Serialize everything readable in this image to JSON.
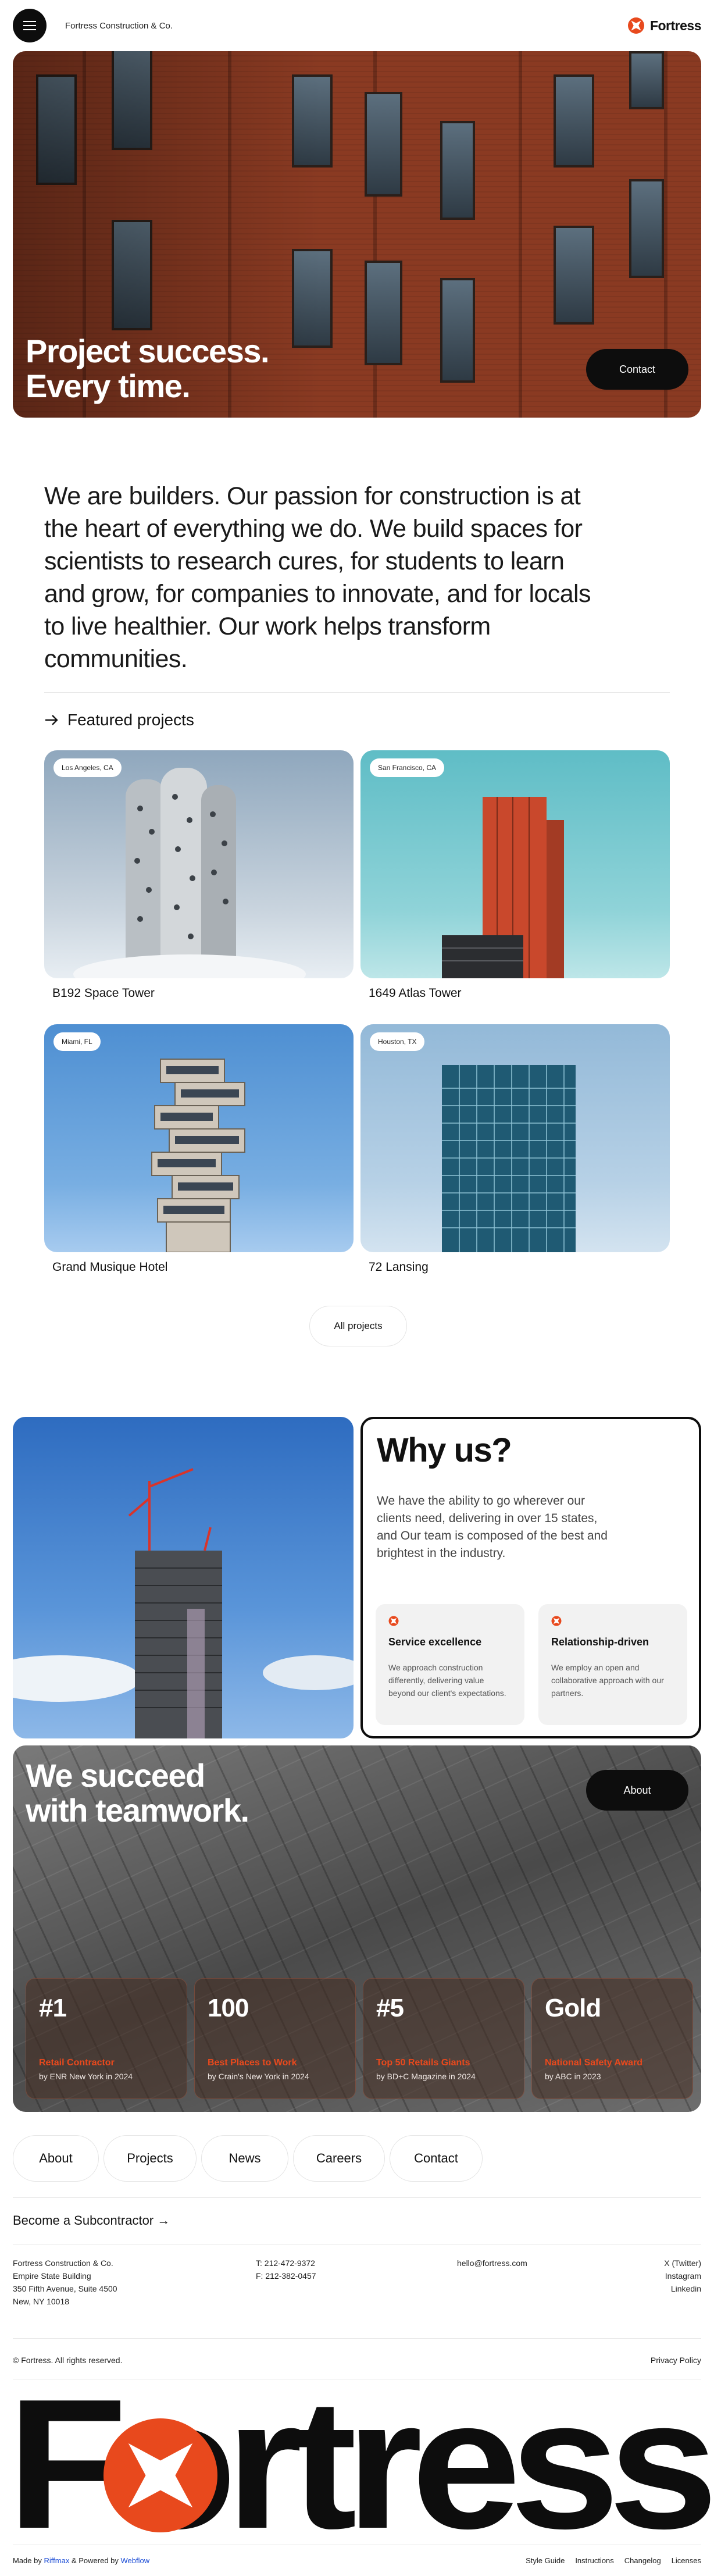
{
  "header": {
    "company": "Fortress Construction & Co.",
    "brand": "Fortress"
  },
  "hero": {
    "title_line1": "Project success.",
    "title_line2": "Every time.",
    "contact_label": "Contact"
  },
  "intro": {
    "text": "We are builders. Our passion for construction is at the heart of everything we do. We build spaces for scientists to research cures, for students to learn and grow, for companies to innovate, and for locals to live healthier. Our work helps transform communities."
  },
  "featured": {
    "heading": "Featured projects",
    "projects": [
      {
        "location": "Los Angeles, CA",
        "name": "B192 Space Tower"
      },
      {
        "location": "San Francisco, CA",
        "name": "1649 Atlas Tower"
      },
      {
        "location": "Miami, FL",
        "name": "Grand Musique Hotel"
      },
      {
        "location": "Houston, TX",
        "name": "72 Lansing"
      }
    ],
    "all_label": "All projects"
  },
  "why": {
    "title": "Why us?",
    "text": "We have the ability to go wherever our clients need, delivering in over 15 states, and Our team is composed of the best and brightest in the industry.",
    "features": [
      {
        "title": "Service excellence",
        "text": "We approach construction differently, delivering value beyond our client's expectations."
      },
      {
        "title": "Relationship-driven",
        "text": "We employ an open and collaborative approach with our partners."
      }
    ]
  },
  "team": {
    "title_line1": "We succeed",
    "title_line2": "with teamwork.",
    "about_label": "About",
    "stats": [
      {
        "value": "#1",
        "label": "Retail Contractor",
        "source": "by ENR New York in 2024"
      },
      {
        "value": "100",
        "label": "Best Places to Work",
        "source": "by Crain's New York in 2024"
      },
      {
        "value": "#5",
        "label": "Top 50 Retails Giants",
        "source": "by BD+C Magazine in 2024"
      },
      {
        "value": "Gold",
        "label": "National Safety Award",
        "source": "by ABC in 2023"
      }
    ]
  },
  "nav": [
    "About",
    "Projects",
    "News",
    "Careers",
    "Contact"
  ],
  "footer": {
    "subcontractor": "Become a Subcontractor →",
    "address": [
      "Fortress Construction & Co.",
      "Empire State Building",
      "350 Fifth Avenue, Suite 4500",
      "New, NY 10018"
    ],
    "phone": "T: 212-472-9372",
    "fax": "F: 212-382-0457",
    "email": "hello@fortress.com",
    "social": [
      "X (Twitter)",
      "Instagram",
      "Linkedin"
    ],
    "copyright": "© Fortress. All rights reserved.",
    "privacy": "Privacy Policy",
    "wordmark": "Fortress",
    "made_prefix": "Made by",
    "made_by": "Riffmax",
    "powered_prefix": "& Powered by",
    "powered_by": "Webflow",
    "bottom_links": [
      "Style Guide",
      "Instructions",
      "Changelog",
      "Licenses"
    ]
  },
  "colors": {
    "accent": "#e8491d",
    "dark": "#0d0d0d"
  }
}
